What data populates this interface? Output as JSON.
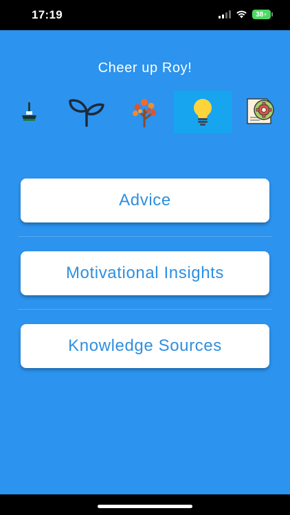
{
  "status_bar": {
    "time": "17:19",
    "battery": "38"
  },
  "header": {
    "greeting": "Cheer up Roy!"
  },
  "icons": [
    {
      "name": "broom-icon",
      "active": false
    },
    {
      "name": "sprout-icon",
      "active": false
    },
    {
      "name": "autumn-tree-icon",
      "active": false
    },
    {
      "name": "lightbulb-icon",
      "active": true
    },
    {
      "name": "gear-document-icon",
      "active": false
    }
  ],
  "menu": {
    "advice_label": "Advice",
    "motivational_label": "Motivational Insights",
    "knowledge_label": "Knowledge Sources"
  },
  "colors": {
    "background": "#2c93ee",
    "active_tile": "#17a5ef",
    "button_text": "#2e8fdf"
  }
}
